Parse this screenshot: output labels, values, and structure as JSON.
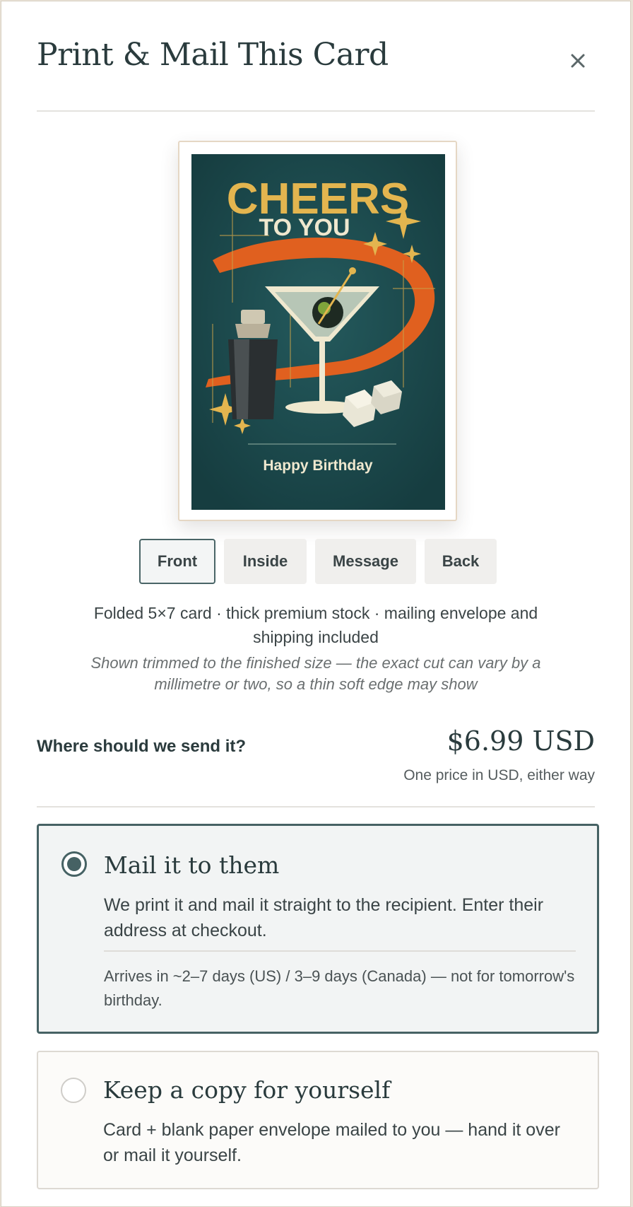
{
  "modal": {
    "title": "Print & Mail This Card",
    "close_icon": "close-icon"
  },
  "card_preview": {
    "headline": "CHEERS",
    "subheadline": "TO YOU",
    "caption": "Happy Birthday",
    "colors": {
      "background": "#1c4b4e",
      "gold": "#e3b54f",
      "orange": "#e0601f",
      "cream": "#efe8cf"
    }
  },
  "view_tabs": [
    {
      "label": "Front",
      "active": true
    },
    {
      "label": "Inside",
      "active": false
    },
    {
      "label": "Message",
      "active": false
    },
    {
      "label": "Back",
      "active": false
    }
  ],
  "description": {
    "main": "Folded 5×7 card · thick premium stock · mailing envelope and shipping included",
    "note": "Shown trimmed to the finished size — the exact cut can vary by a millimetre or two, so a thin soft edge may show"
  },
  "shipping": {
    "question": "Where should we send it?",
    "price": "$6.99 USD",
    "price_note": "One price in USD, either way"
  },
  "options": {
    "mail_to_them": {
      "title": "Mail it to them",
      "body": "We print it and mail it straight to the recipient. Enter their address at checkout.",
      "note": "Arrives in ~2–7 days (US) / 3–9 days (Canada) — not for tomorrow's birthday.",
      "selected": true
    },
    "keep_copy": {
      "title": "Keep a copy for yourself",
      "body": "Card + blank paper envelope mailed to you — hand it over or mail it yourself.",
      "selected": false
    }
  },
  "colors": {
    "accent": "#466264",
    "text": "#2a3b3d"
  }
}
